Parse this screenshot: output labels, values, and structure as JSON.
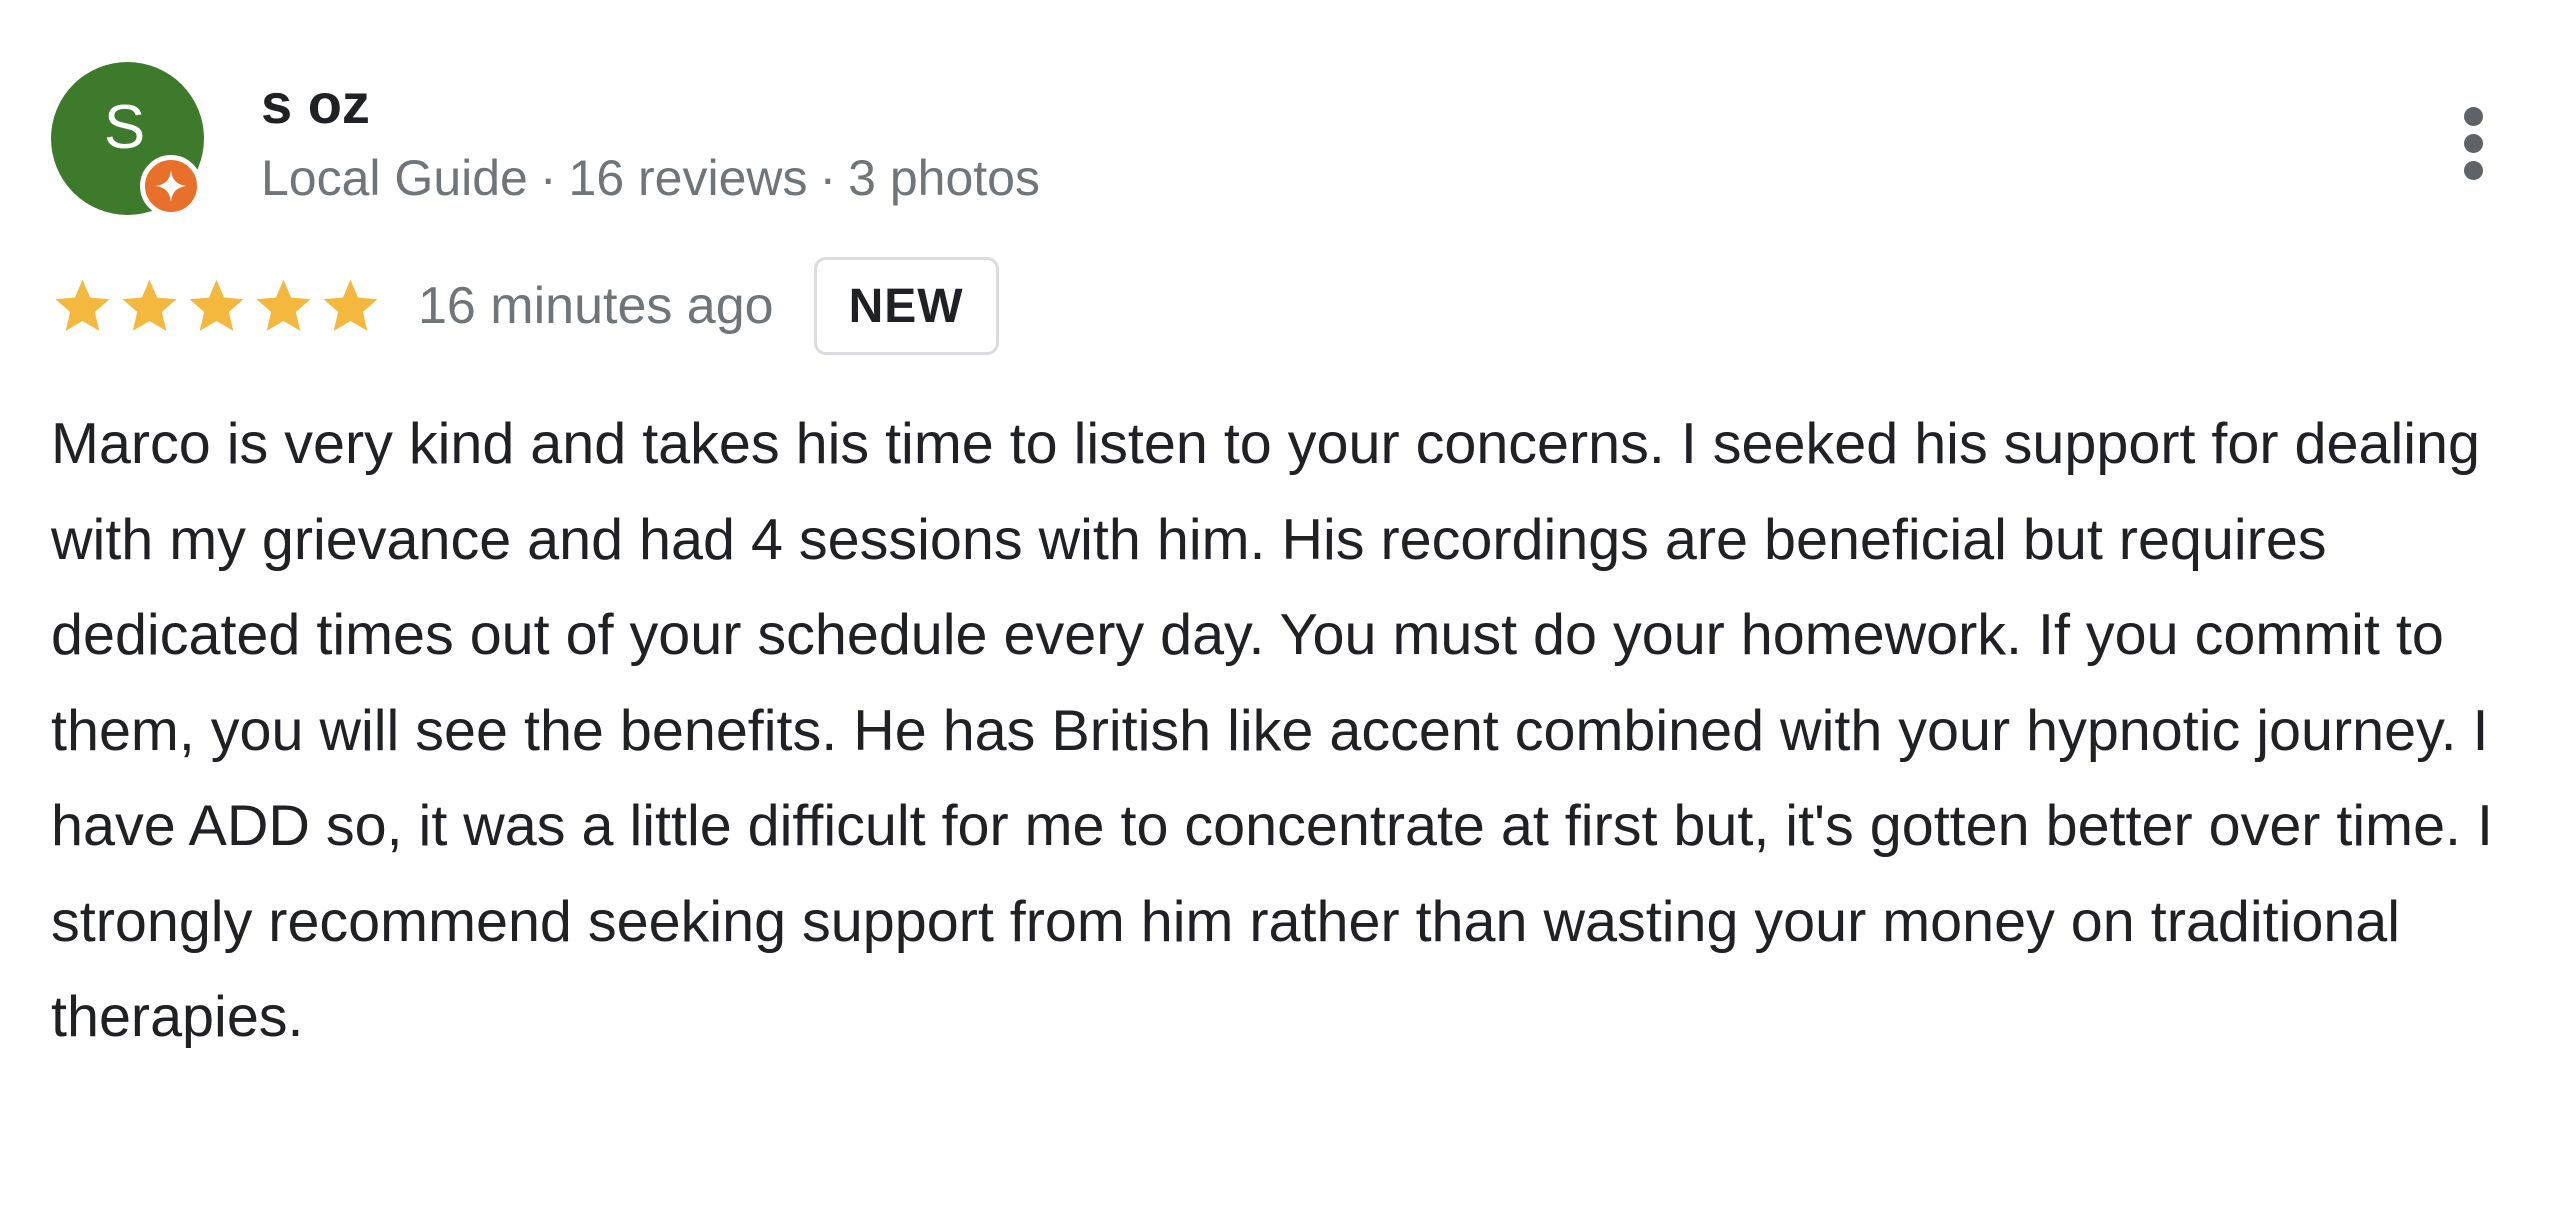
{
  "reviewer": {
    "name": "s oz",
    "avatar_initial": "S",
    "avatar_color": "#3e7a2b",
    "badge_color": "#e8702a",
    "badge_icon": "local-guide-icon",
    "meta": {
      "role": "Local Guide",
      "reviews": "16 reviews",
      "photos": "3 photos",
      "separator": "·"
    }
  },
  "menu": {
    "icon": "more-vertical-icon"
  },
  "rating": {
    "stars": 5,
    "max_stars": 5,
    "star_color": "#f4b83f",
    "time": "16 minutes ago",
    "badge_label": "NEW"
  },
  "review": {
    "text": "Marco is very kind and takes his time to listen to your concerns. I seeked his support for dealing with my grievance and had 4 sessions with him. His recordings are beneficial but requires dedicated times out of your schedule every day. You must do your homework. If you commit to them, you will see the benefits. He has British like accent combined with your hypnotic journey. I have ADD so, it was a little difficult for me to concentrate at first but, it's gotten better over time. I strongly recommend seeking support from him rather than wasting your money on traditional therapies."
  }
}
